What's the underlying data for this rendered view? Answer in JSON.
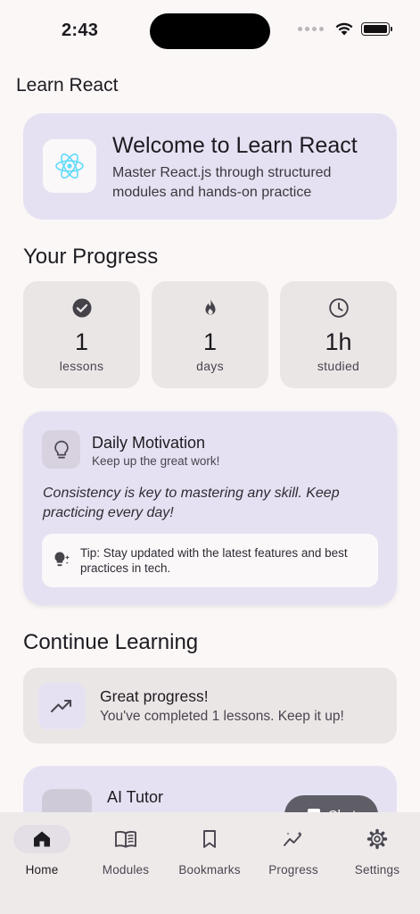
{
  "status_bar": {
    "time": "2:43"
  },
  "app_title": "Learn React",
  "welcome": {
    "title": "Welcome to Learn React",
    "subtitle": "Master React.js through structured modules and hands-on practice"
  },
  "progress": {
    "heading": "Your Progress",
    "stats": [
      {
        "icon": "check-circle-icon",
        "value": "1",
        "label": "lessons"
      },
      {
        "icon": "fire-icon",
        "value": "1",
        "label": "days"
      },
      {
        "icon": "clock-icon",
        "value": "1h",
        "label": "studied"
      }
    ]
  },
  "motivation": {
    "title": "Daily Motivation",
    "subtitle": "Keep up the great work!",
    "quote": "Consistency is key to mastering any skill. Keep practicing every day!",
    "tip": "Tip: Stay updated with the latest features and best practices in tech."
  },
  "continue_learning": {
    "heading": "Continue Learning",
    "title": "Great progress!",
    "subtitle": "You've completed 1 lessons. Keep it up!"
  },
  "ai_tutor": {
    "title": "AI Tutor",
    "button_label": "Chat"
  },
  "bottom_nav": {
    "items": [
      {
        "label": "Home",
        "icon": "home-icon",
        "active": true
      },
      {
        "label": "Modules",
        "icon": "book-icon",
        "active": false
      },
      {
        "label": "Bookmarks",
        "icon": "bookmark-icon",
        "active": false
      },
      {
        "label": "Progress",
        "icon": "trending-icon",
        "active": false
      },
      {
        "label": "Settings",
        "icon": "gear-icon",
        "active": false
      }
    ]
  },
  "colors": {
    "background": "#fbf7f7",
    "card_primary": "#e6e1f2",
    "card_neutral": "#ebe6e6",
    "react_logo": "#61dafb",
    "chat_button": "#5f5d66"
  }
}
